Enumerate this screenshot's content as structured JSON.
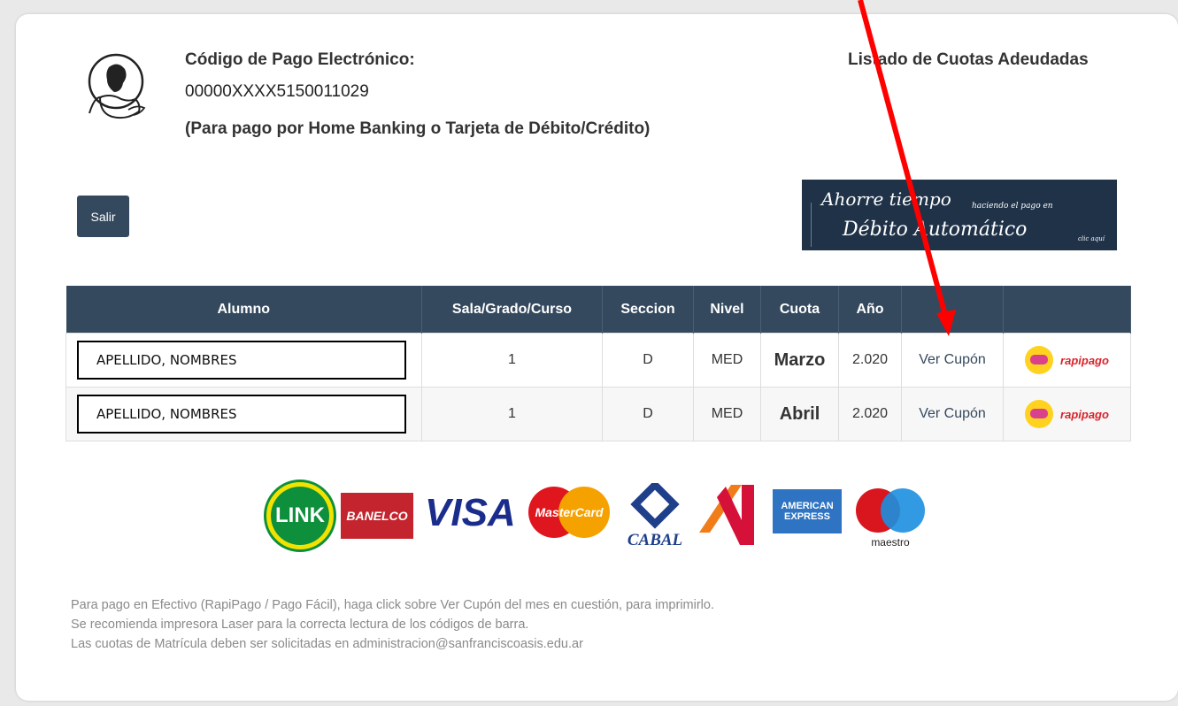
{
  "header": {
    "title": "Código de Pago Electrónico:",
    "code": "00000XXXX5150011029",
    "note": "(Para pago por Home Banking o Tarjeta de Débito/Crédito)",
    "right_title": "Listado de Cuotas Adeudadas"
  },
  "toolbar": {
    "salir_label": "Salir"
  },
  "banner": {
    "line1": "Ahorre tiempo",
    "line1_small": "haciendo el pago en",
    "line2": "Débito Automático",
    "cta": "clic aquí"
  },
  "table": {
    "columns": [
      "Alumno",
      "Sala/Grado/Curso",
      "Seccion",
      "Nivel",
      "Cuota",
      "Año",
      "",
      ""
    ],
    "rows": [
      {
        "alumno": "APELLIDO, NOMBRES",
        "curso": "1",
        "seccion": "D",
        "nivel": "MED",
        "cuota": "Marzo",
        "anio": "2.020",
        "link": "Ver Cupón",
        "pago": "rapipago"
      },
      {
        "alumno": "APELLIDO, NOMBRES",
        "curso": "1",
        "seccion": "D",
        "nivel": "MED",
        "cuota": "Abril",
        "anio": "2.020",
        "link": "Ver Cupón",
        "pago": "rapipago"
      }
    ]
  },
  "payment_logos": {
    "link": "LINK",
    "banelco": "BANELCO",
    "visa": "VISA",
    "mastercard": "MasterCard",
    "cabal": "CABAL",
    "amex_1": "AMERICAN",
    "amex_2": "EXPRESS",
    "maestro": "maestro"
  },
  "footer": {
    "line1": "Para pago en Efectivo (RapiPago / Pago Fácil), haga click sobre Ver Cupón del mes en cuestión, para imprimirlo.",
    "line2": "Se recomienda impresora Laser para la correcta lectura de los códigos de barra.",
    "line3": "Las cuotas de Matrícula deben ser solicitadas en administracion@sanfranciscoasis.edu.ar"
  },
  "colors": {
    "header_bg": "#34495e",
    "accent_arrow": "#ff0000",
    "link": "#34495e"
  }
}
